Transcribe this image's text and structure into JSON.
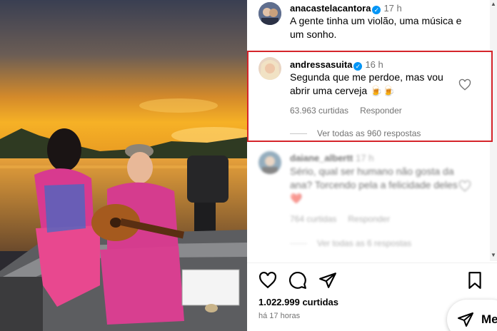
{
  "comments": [
    {
      "username": "anacastelacantora",
      "time": "17 h",
      "text": "A gente tinha um violão, uma música e um sonho."
    },
    {
      "username": "andressasuita",
      "time": "16 h",
      "text": "Segunda que me perdoe, mas vou abrir uma cerveja 🍺🍺",
      "likes": "63.963 curtidas",
      "reply_label": "Responder",
      "view_replies": "Ver todas as 960 respostas"
    },
    {
      "username": "daiane_albertt",
      "time": "17 h",
      "text": "Sério, qual ser humano não gosta da ana? Torcendo pela a felicidade deles ❤️",
      "likes": "764 curtidas",
      "reply_label": "Responder",
      "view_replies": "Ver todas as 6 respostas"
    }
  ],
  "post": {
    "likes": "1.022.999 curtidas",
    "time_ago": "há 17 horas"
  },
  "share_pill": {
    "label": "Me"
  },
  "icons": {
    "like": "heart-icon",
    "comment": "comment-icon",
    "share": "send-icon",
    "save": "bookmark-icon"
  },
  "colors": {
    "highlight": "#d5242a",
    "verified": "#0095f6",
    "meta_text": "#737373"
  }
}
